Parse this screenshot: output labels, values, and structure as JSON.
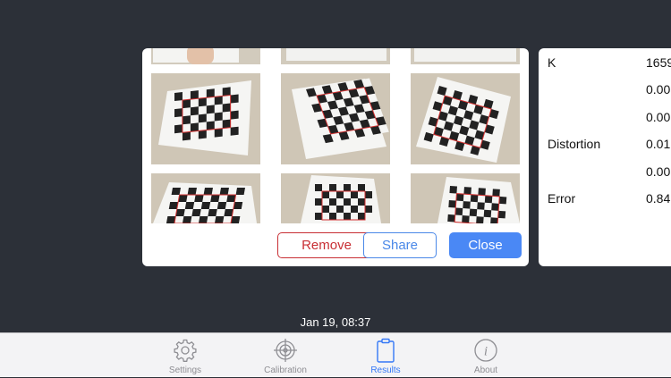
{
  "gallery": {
    "buttons": {
      "remove": "Remove",
      "share": "Share",
      "close": "Close"
    }
  },
  "results": {
    "rows": [
      {
        "label": "K",
        "value": "1659"
      },
      {
        "label": "",
        "value": "0.00"
      },
      {
        "label": "",
        "value": "0.00"
      },
      {
        "label": "Distortion",
        "value": "0.01"
      },
      {
        "label": "",
        "value": "0.00"
      },
      {
        "label": "Error",
        "value": "0.84"
      }
    ]
  },
  "timestamp": "Jan 19, 08:37",
  "tabbar": {
    "tabs": [
      {
        "label": "Settings",
        "icon": "gear-icon",
        "active": false
      },
      {
        "label": "Calibration",
        "icon": "target-icon",
        "active": false
      },
      {
        "label": "Results",
        "icon": "clipboard-icon",
        "active": true
      },
      {
        "label": "About",
        "icon": "info-icon",
        "active": false
      }
    ]
  },
  "colors": {
    "background": "#2c3038",
    "accent": "#3478f6",
    "destructive": "#c82f34",
    "tab_inactive": "#8e8e93"
  }
}
